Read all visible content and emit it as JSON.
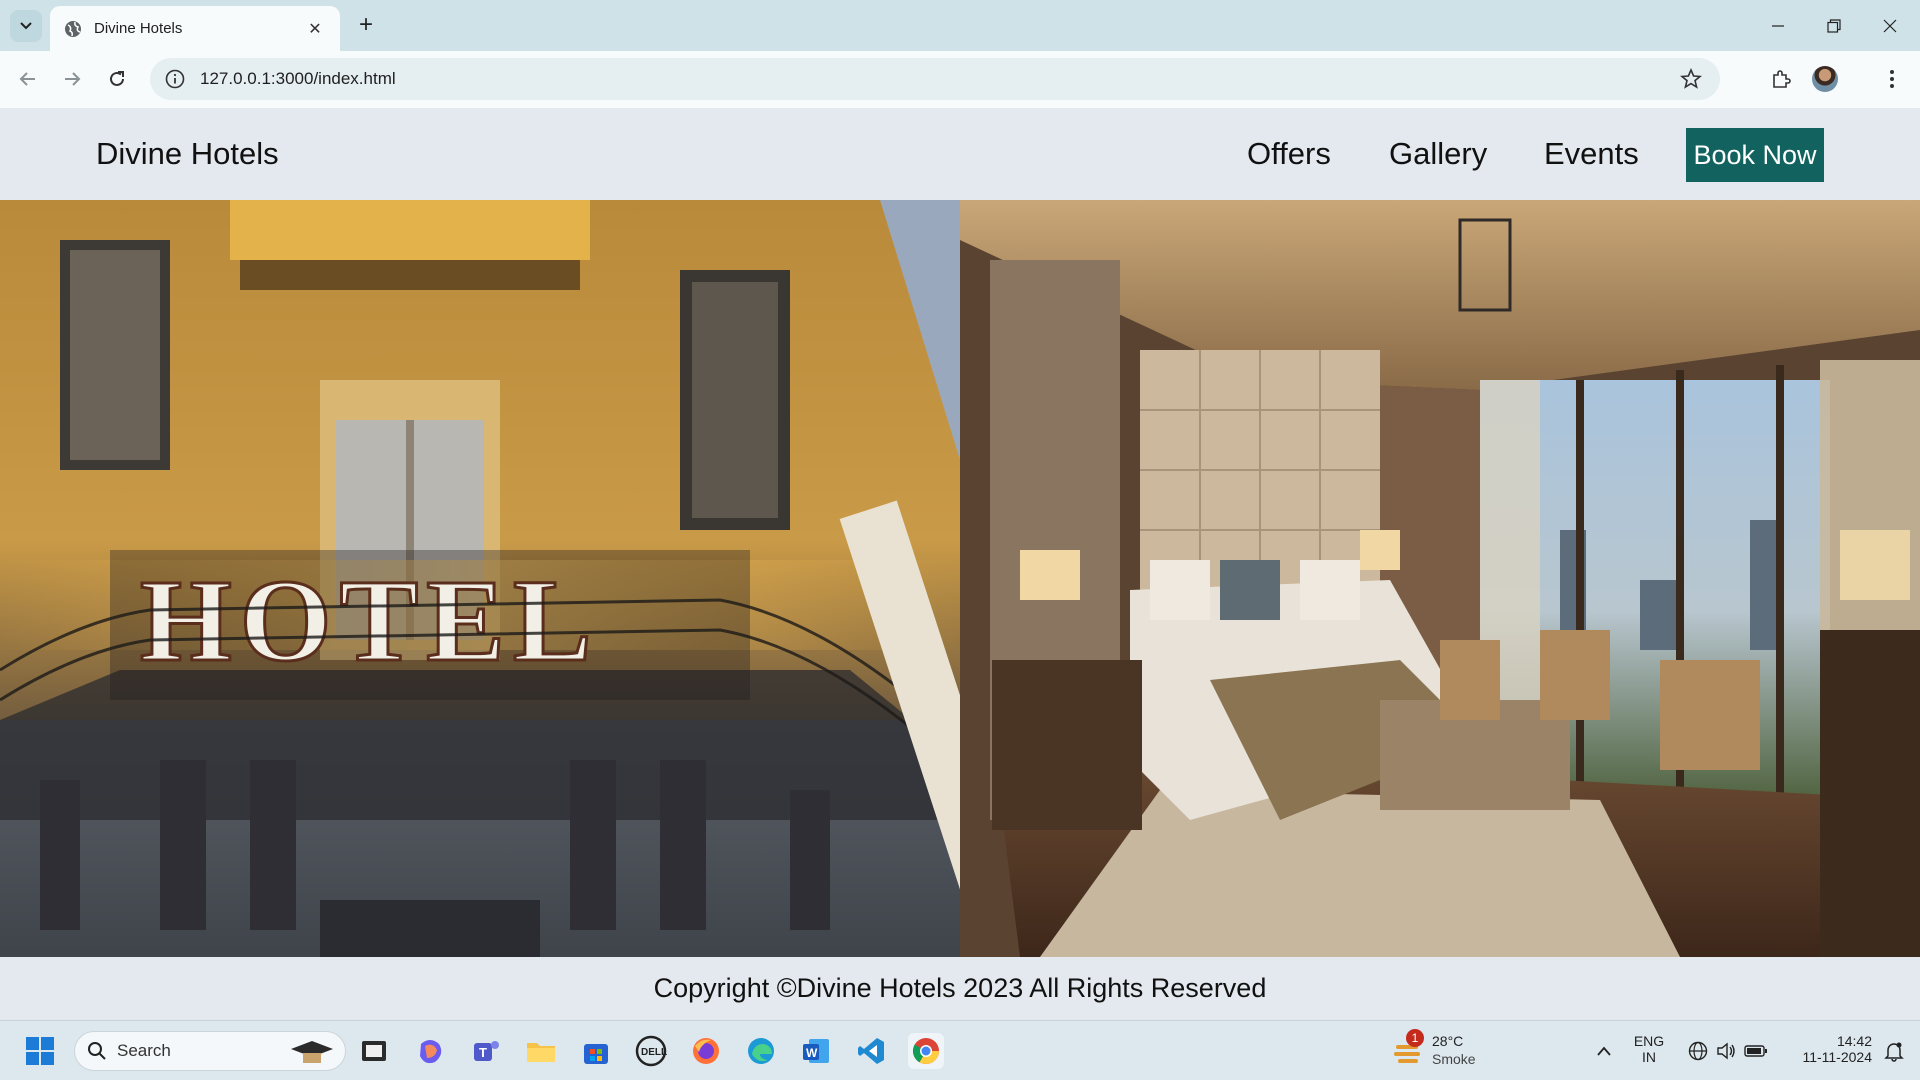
{
  "browser": {
    "tab_title": "Divine Hotels",
    "url": "127.0.0.1:3000/index.html"
  },
  "site": {
    "brand": "Divine Hotels",
    "nav": [
      "Offers",
      "Gallery",
      "Events"
    ],
    "cta": "Book Now",
    "footer": "Copyright ©Divine Hotels 2023 All Rights Reserved",
    "hero_left_sign": "HOTEL",
    "colors": {
      "cta_bg": "#12635f",
      "header_bg": "#e3e9ee"
    }
  },
  "taskbar": {
    "search_placeholder": "Search",
    "weather_temp": "28°C",
    "weather_cond": "Smoke",
    "weather_badge": "1",
    "lang_line1": "ENG",
    "lang_line2": "IN",
    "time": "14:42",
    "date": "11-11-2024",
    "icons": [
      "windows-start-icon",
      "search-icon",
      "file-manager-icon",
      "copilot-icon",
      "teams-icon",
      "folder-icon",
      "store-icon",
      "dell-icon",
      "firefox-icon",
      "edge-icon",
      "word-icon",
      "vscode-icon",
      "chrome-icon"
    ]
  }
}
